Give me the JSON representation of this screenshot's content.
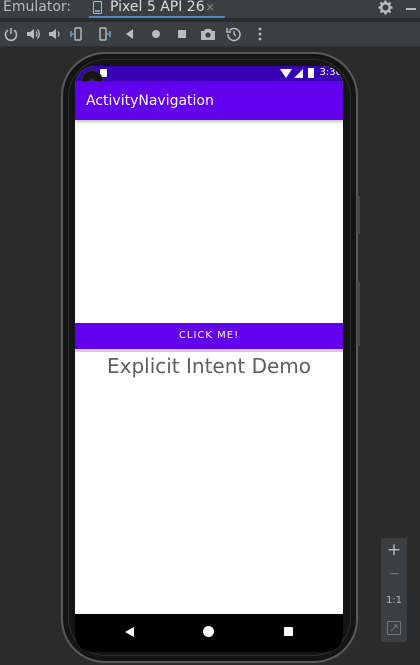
{
  "emulator": {
    "label": "Emulator:",
    "tab_label": "Pixel 5 API 26",
    "tab_close": "×"
  },
  "toolbar": {
    "buttons": [
      "power-icon",
      "volume-up-icon",
      "volume-down-icon",
      "rotate-left-icon",
      "rotate-right-icon",
      "back-icon",
      "home-icon",
      "overview-icon",
      "camera-icon",
      "replay-icon",
      "more-icon"
    ]
  },
  "device": {
    "status_time": "3:36",
    "app_title": "ActivityNavigation",
    "button_label": "CLICK ME!",
    "demo_text": "Explicit Intent Demo"
  },
  "zoom": {
    "plus": "+",
    "minus": "−",
    "one_to_one": "1:1"
  },
  "colors": {
    "status_bar": "#3700b3",
    "app_bar": "#6200ee",
    "ide_background": "#2b2b2b",
    "toolbar_background": "#3c3f41"
  }
}
